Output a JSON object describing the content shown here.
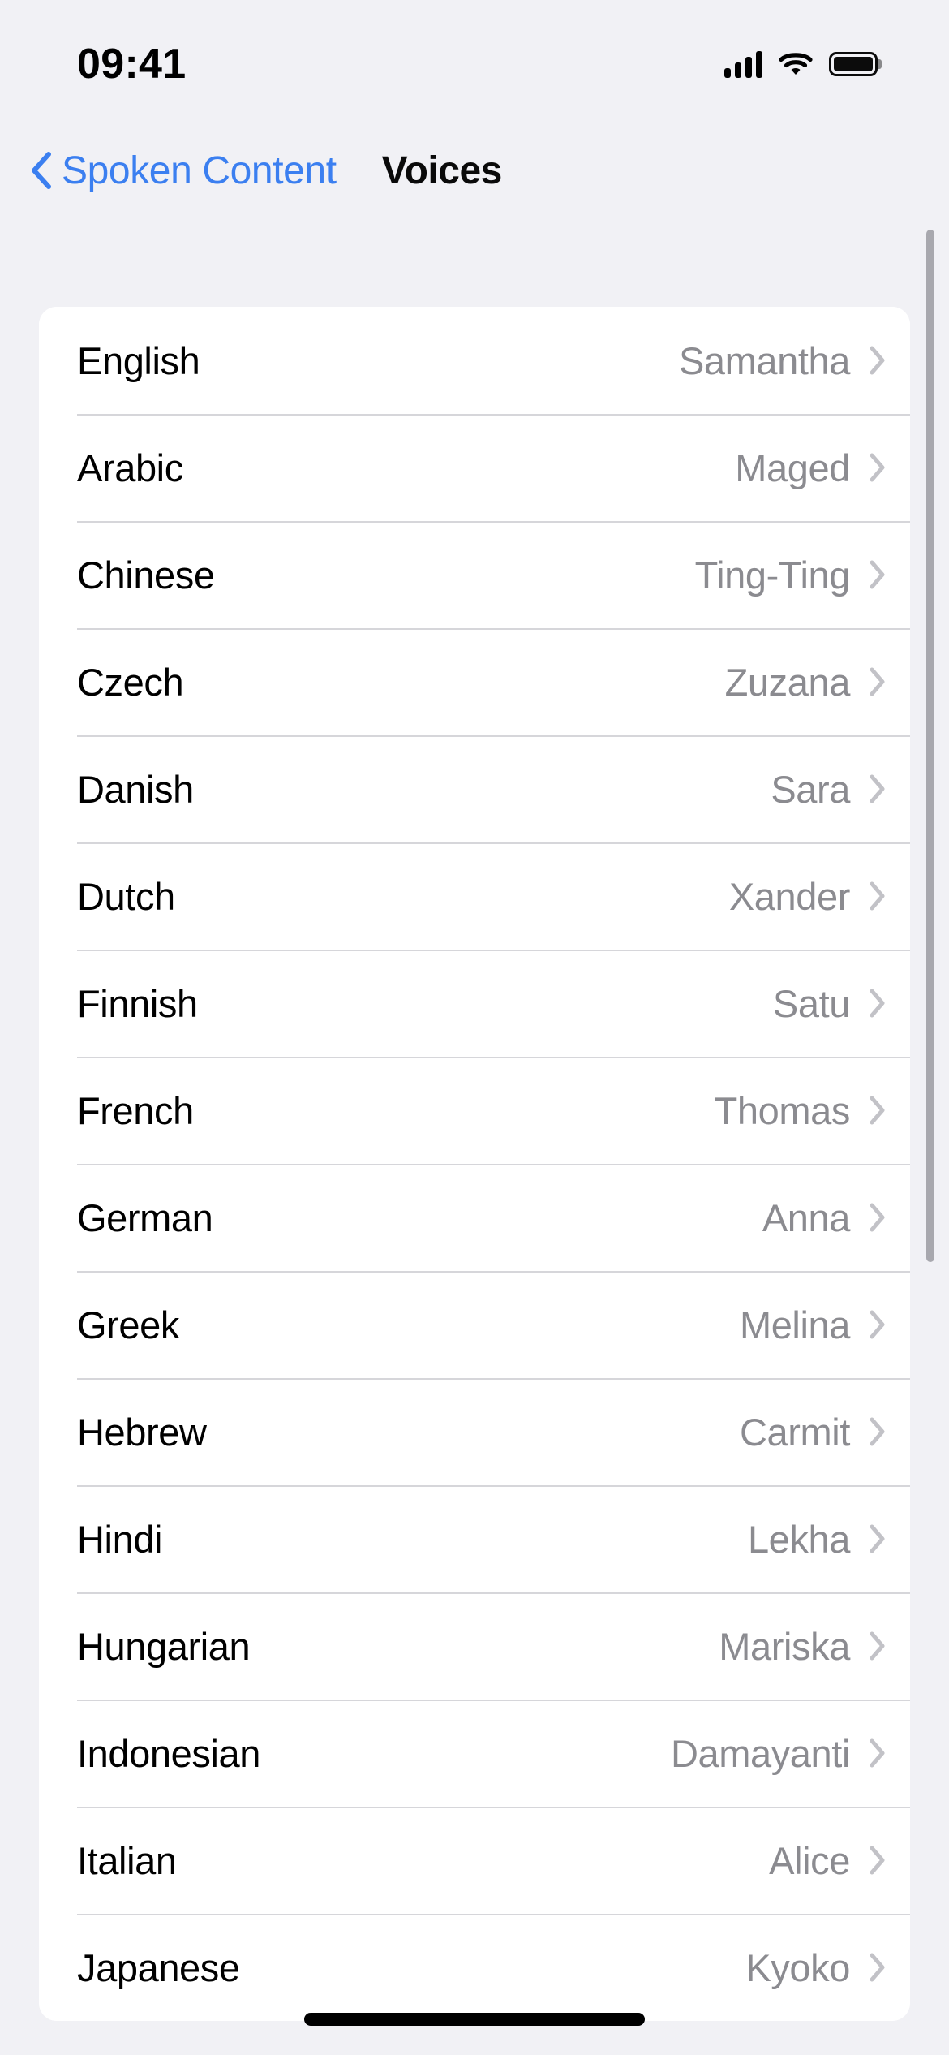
{
  "status_bar": {
    "time": "09:41",
    "cellular_icon": "cellular-signal-icon",
    "wifi_icon": "wifi-icon",
    "battery_icon": "battery-full-icon"
  },
  "nav_bar": {
    "back_icon": "chevron-left-icon",
    "back_label": "Spoken Content",
    "title": "Voices"
  },
  "colors": {
    "accent": "#3b7ff0",
    "background": "#f1f1f5",
    "card": "#ffffff",
    "separator": "#d6d6da",
    "value_text": "#8b8b90",
    "label_text": "#000000"
  },
  "list": {
    "disclosure_icon": "chevron-right-icon",
    "rows": [
      {
        "language": "English",
        "voice": "Samantha"
      },
      {
        "language": "Arabic",
        "voice": "Maged"
      },
      {
        "language": "Chinese",
        "voice": "Ting-Ting"
      },
      {
        "language": "Czech",
        "voice": "Zuzana"
      },
      {
        "language": "Danish",
        "voice": "Sara"
      },
      {
        "language": "Dutch",
        "voice": "Xander"
      },
      {
        "language": "Finnish",
        "voice": "Satu"
      },
      {
        "language": "French",
        "voice": "Thomas"
      },
      {
        "language": "German",
        "voice": "Anna"
      },
      {
        "language": "Greek",
        "voice": "Melina"
      },
      {
        "language": "Hebrew",
        "voice": "Carmit"
      },
      {
        "language": "Hindi",
        "voice": "Lekha"
      },
      {
        "language": "Hungarian",
        "voice": "Mariska"
      },
      {
        "language": "Indonesian",
        "voice": "Damayanti"
      },
      {
        "language": "Italian",
        "voice": "Alice"
      },
      {
        "language": "Japanese",
        "voice": "Kyoko"
      }
    ]
  },
  "scroll_indicator": {
    "name": "vertical-scrollbar"
  },
  "home_indicator": {
    "name": "home-indicator"
  }
}
